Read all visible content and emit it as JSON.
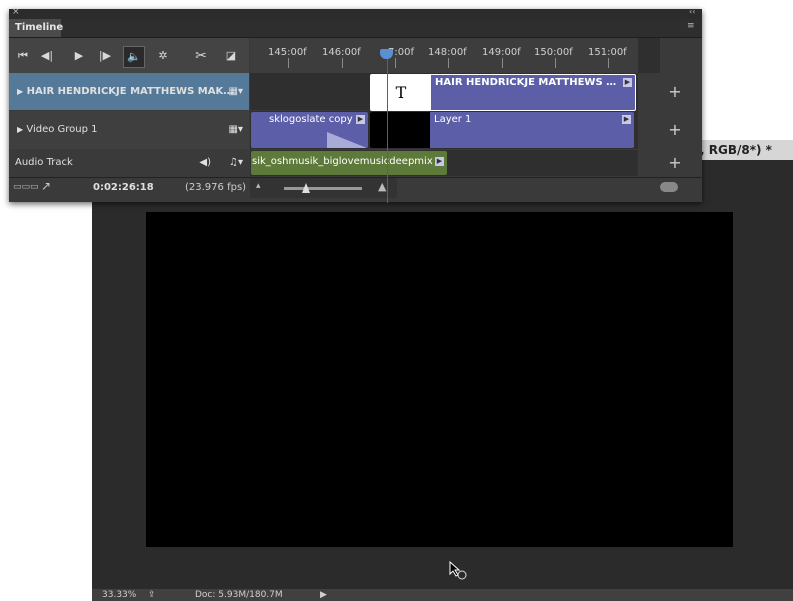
{
  "document": {
    "tab_title": ", RGB/8*) *",
    "status": {
      "zoom": "33.33%",
      "doc_size": "Doc: 5.93M/180.7M"
    }
  },
  "timeline": {
    "close_glyph": "×",
    "collapse_glyph": "‹‹",
    "panel_menu_glyph": "≡",
    "tab_label": "Timeline",
    "controls": {
      "go_first": "⏮",
      "prev_frame": "◀|",
      "play": "▶",
      "next_frame": "|▶",
      "audio": "🔈",
      "settings": "✲",
      "split": "✂",
      "transition": "◪"
    },
    "ruler": {
      "labels": [
        "145:00f",
        "146:00f",
        "7:00f",
        "148:00f",
        "149:00f",
        "150:00f",
        "151:00f"
      ]
    },
    "tracks": [
      {
        "label": "HAIR  HENDRICKJE MATTHEWS  MAK…",
        "clips": [
          {
            "text_icon": "T",
            "label": "HAIR  HENDRICKJE MATTHEWS  …"
          }
        ]
      },
      {
        "label": "Video Group 1",
        "clips": [
          {
            "label": "sklogoslate copy"
          },
          {
            "label": "Layer 1"
          }
        ]
      },
      {
        "label": "Audio Track",
        "clips": [
          {
            "label": "sik_oshmusik_biglovemusicdeepmix"
          }
        ]
      }
    ],
    "plus_label": "+",
    "bottom": {
      "timecode": "0:02:26:18",
      "fps": "(23.976 fps)"
    }
  },
  "icons": {
    "track-expand": "triangle-right",
    "film": "film-icon",
    "audio-volume": "speaker-icon",
    "music-note": "music-icon"
  }
}
